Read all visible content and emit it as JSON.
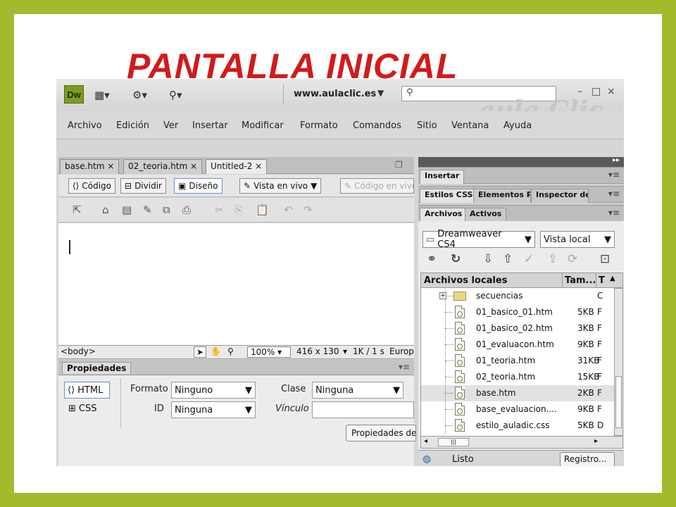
{
  "slide_title": "PANTALLA  INICIAL",
  "app": {
    "logo": "Dw",
    "site": "www.aulaclic.es",
    "watermark": "aula Clic",
    "window_controls": [
      "–",
      "□",
      "×"
    ]
  },
  "menu": [
    "Archivo",
    "Edición",
    "Ver",
    "Insertar",
    "Modificar",
    "Formato",
    "Comandos",
    "Sitio",
    "Ventana",
    "Ayuda"
  ],
  "doc_tabs": [
    {
      "label": "base.htm"
    },
    {
      "label": "02_teoria.htm"
    },
    {
      "label": "Untitled-2"
    }
  ],
  "view_buttons": {
    "codigo": "Código",
    "dividir": "Dividir",
    "diseno": "Diseño",
    "vista_en_vivo": "Vista en vivo",
    "codigo_en_vivo": "Código en vivo"
  },
  "status": {
    "tag": "<body>",
    "zoom": "100%",
    "size": "416 x 130",
    "speed": "1K / 1 s",
    "encoding": "Europ"
  },
  "properties": {
    "tab": "Propiedades",
    "html": "HTML",
    "css": "CSS",
    "formato_label": "Formato",
    "formato_value": "Ninguno",
    "id_label": "ID",
    "id_value": "Ninguna",
    "clase_label": "Clase",
    "clase_value": "Ninguna",
    "vinculo_label": "Vínculo",
    "page_props_button": "Propiedades de"
  },
  "panels": {
    "insertar": "Insertar",
    "estilos_css": "Estilos CSS",
    "elementos": "Elementos PA",
    "inspector": "Inspector de",
    "archivos": "Archivos",
    "activos": "Activos",
    "site_select": "Dreamweaver CS4",
    "view_select": "Vista local",
    "tree_header": "Archivos locales",
    "size_header": "Tam...",
    "type_header": "T",
    "status_text": "Listo",
    "registro_button": "Registro..."
  },
  "files": [
    {
      "name": "secuencias",
      "size": "",
      "type": "C",
      "folder": true
    },
    {
      "name": "01_basico_01.htm",
      "size": "5KB",
      "type": "F"
    },
    {
      "name": "01_basico_02.htm",
      "size": "3KB",
      "type": "F"
    },
    {
      "name": "01_evaluacon.htm",
      "size": "9KB",
      "type": "F"
    },
    {
      "name": "01_teoria.htm",
      "size": "31KB",
      "type": "F"
    },
    {
      "name": "02_teoria.htm",
      "size": "15KB",
      "type": "F"
    },
    {
      "name": "base.htm",
      "size": "2KB",
      "type": "F",
      "selected": true
    },
    {
      "name": "base_evaluacion....",
      "size": "9KB",
      "type": "F"
    },
    {
      "name": "estilo_auladic.css",
      "size": "5KB",
      "type": "D"
    }
  ],
  "colors": {
    "frame": "#a4b92b",
    "title": "#d11b1b",
    "logo": "#7e9b1f"
  }
}
